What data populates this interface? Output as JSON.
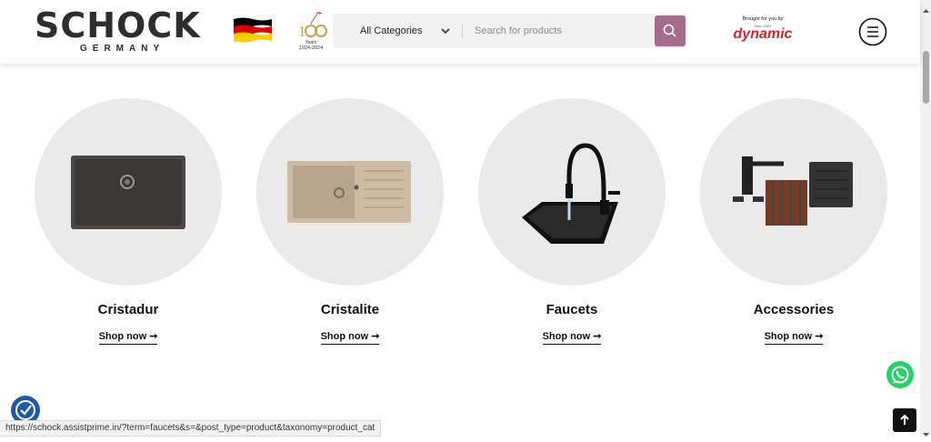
{
  "header": {
    "logo_main": "SCHOCK",
    "logo_sub": "GERMANY",
    "anniversary_years": "Years",
    "anniversary_dates": "1924-2024",
    "category_label": "All Categories",
    "search_placeholder": "Search for products",
    "partner_tagline": "Brought for you by",
    "partner_est": "Estd. 1991",
    "partner_name": "dynamic"
  },
  "categories": [
    {
      "title": "Cristadur",
      "link": "Shop now"
    },
    {
      "title": "Cristalite",
      "link": "Shop now"
    },
    {
      "title": "Faucets",
      "link": "Shop now"
    },
    {
      "title": "Accessories",
      "link": "Shop now"
    }
  ],
  "status_url": "https://schock.assistprime.in/?term=faucets&s=&post_type=product&taxonomy=product_cat",
  "colors": {
    "search_button": "#a86b8c",
    "circle_bg": "#eaeaea",
    "whatsapp": "#25d366",
    "accessibility": "#1e5aa8",
    "brand_red": "#d6232a"
  }
}
